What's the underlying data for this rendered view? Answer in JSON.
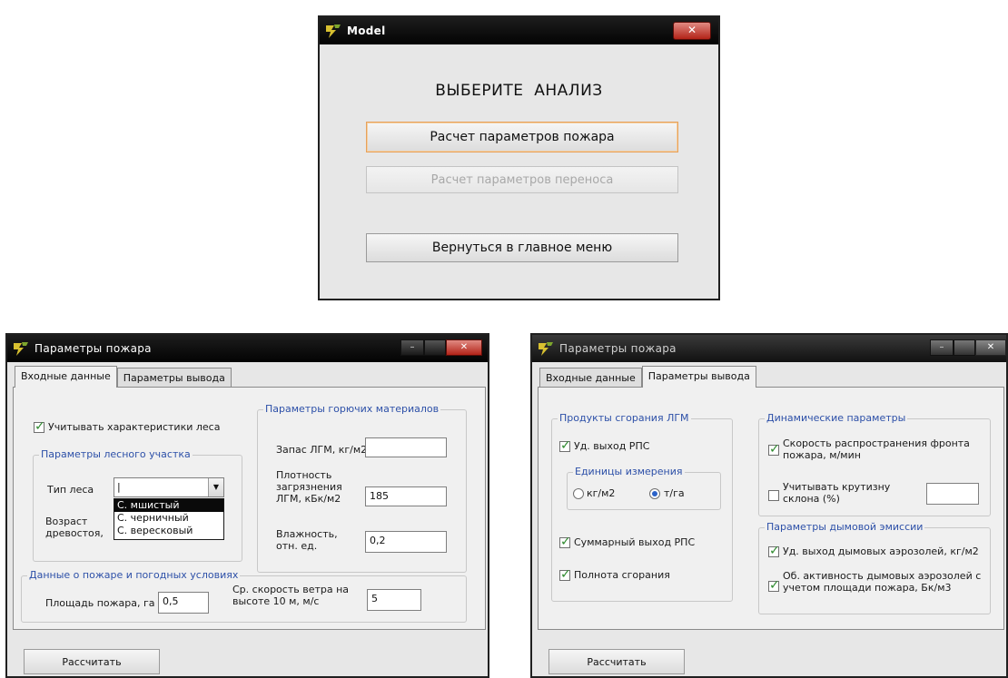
{
  "model_window": {
    "title": "Model",
    "close_glyph": "✕",
    "heading": "ВЫБЕРИТЕ  АНАЛИЗ",
    "buttons": {
      "fire_calc": "Расчет параметров пожара",
      "transfer_calc": "Расчет параметров переноса",
      "main_menu": "Вернуться в главное меню"
    }
  },
  "fire_input_window": {
    "title": "Параметры пожара",
    "tabs": {
      "input": "Входные данные",
      "output": "Параметры вывода"
    },
    "account_forest": {
      "label": "Учитывать характеристики леса",
      "checked": true
    },
    "forest_group": {
      "title": "Параметры лесного участка",
      "forest_type_label": "Тип леса",
      "forest_type_value": "|",
      "age_label": "Возраст древостоя,",
      "options": [
        "С. мшистый",
        "С. черничный",
        "С. вересковый"
      ],
      "selected_option": "С. мшистый"
    },
    "fuel_group": {
      "title": "Параметры горючих материалов",
      "stock_label": "Запас ЛГМ, кг/м2",
      "stock_value": "",
      "contamination_label": "Плотность загрязнения ЛГМ, кБк/м2",
      "contamination_value": "185",
      "moisture_label": "Влажность, отн. ед.",
      "moisture_value": "0,2"
    },
    "weather_group": {
      "title": "Данные о пожаре и погодных условиях",
      "area_label": "Площадь пожара, га",
      "area_value": "0,5",
      "wind_label": "Ср. скорость ветра на высоте 10 м, м/с",
      "wind_value": "5"
    },
    "calc_button": "Рассчитать",
    "window_controls": {
      "minimize": "–",
      "maximize": "",
      "close": "✕"
    }
  },
  "fire_output_window": {
    "title": "Параметры пожара",
    "tabs": {
      "input": "Входные данные",
      "output": "Параметры вывода"
    },
    "products_group": {
      "title": "Продукты сгорания ЛГМ",
      "specific_yield": {
        "label": "Уд. выход РПС",
        "checked": true
      },
      "units_title": "Единицы измерения",
      "unit_kg": {
        "label": "кг/м2",
        "checked": false
      },
      "unit_t": {
        "label": "т/га",
        "checked": true
      },
      "total_yield": {
        "label": "Суммарный выход РПС",
        "checked": true
      },
      "completeness": {
        "label": "Полнота сгорания",
        "checked": true
      }
    },
    "dynamic_group": {
      "title": "Динамические параметры",
      "front_speed": {
        "label": "Скорость распространения фронта пожара, м/мин",
        "checked": true
      },
      "slope": {
        "label": "Учитывать крутизну склона (%)",
        "checked": false
      },
      "slope_value": ""
    },
    "smoke_group": {
      "title": "Параметры дымовой эмиссии",
      "aerosol_yield": {
        "label": "Уд. выход дымовых аэрозолей, кг/м2",
        "checked": true
      },
      "aerosol_activity": {
        "label": "Об. активность дымовых аэрозолей с учетом площади пожара, Бк/м3",
        "checked": true
      }
    },
    "calc_button": "Рассчитать",
    "window_controls": {
      "minimize": "–",
      "maximize": "",
      "close": "✕"
    }
  },
  "colors": {
    "titlebar": "#0a0a0a",
    "group_label": "#2d50a8",
    "close": "#c0392b",
    "focus": "#e7a15a"
  }
}
